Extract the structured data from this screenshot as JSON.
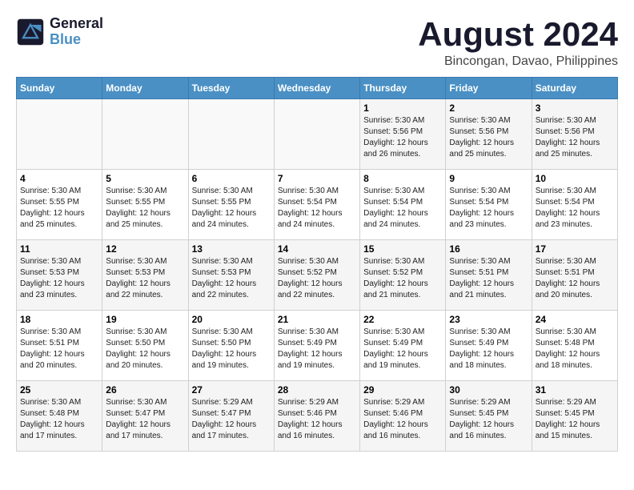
{
  "header": {
    "logo_line1": "General",
    "logo_line2": "Blue",
    "title": "August 2024",
    "subtitle": "Bincongan, Davao, Philippines"
  },
  "days_of_week": [
    "Sunday",
    "Monday",
    "Tuesday",
    "Wednesday",
    "Thursday",
    "Friday",
    "Saturday"
  ],
  "weeks": [
    [
      {
        "day": "",
        "detail": ""
      },
      {
        "day": "",
        "detail": ""
      },
      {
        "day": "",
        "detail": ""
      },
      {
        "day": "",
        "detail": ""
      },
      {
        "day": "1",
        "detail": "Sunrise: 5:30 AM\nSunset: 5:56 PM\nDaylight: 12 hours\nand 26 minutes."
      },
      {
        "day": "2",
        "detail": "Sunrise: 5:30 AM\nSunset: 5:56 PM\nDaylight: 12 hours\nand 25 minutes."
      },
      {
        "day": "3",
        "detail": "Sunrise: 5:30 AM\nSunset: 5:56 PM\nDaylight: 12 hours\nand 25 minutes."
      }
    ],
    [
      {
        "day": "4",
        "detail": "Sunrise: 5:30 AM\nSunset: 5:55 PM\nDaylight: 12 hours\nand 25 minutes."
      },
      {
        "day": "5",
        "detail": "Sunrise: 5:30 AM\nSunset: 5:55 PM\nDaylight: 12 hours\nand 25 minutes."
      },
      {
        "day": "6",
        "detail": "Sunrise: 5:30 AM\nSunset: 5:55 PM\nDaylight: 12 hours\nand 24 minutes."
      },
      {
        "day": "7",
        "detail": "Sunrise: 5:30 AM\nSunset: 5:54 PM\nDaylight: 12 hours\nand 24 minutes."
      },
      {
        "day": "8",
        "detail": "Sunrise: 5:30 AM\nSunset: 5:54 PM\nDaylight: 12 hours\nand 24 minutes."
      },
      {
        "day": "9",
        "detail": "Sunrise: 5:30 AM\nSunset: 5:54 PM\nDaylight: 12 hours\nand 23 minutes."
      },
      {
        "day": "10",
        "detail": "Sunrise: 5:30 AM\nSunset: 5:54 PM\nDaylight: 12 hours\nand 23 minutes."
      }
    ],
    [
      {
        "day": "11",
        "detail": "Sunrise: 5:30 AM\nSunset: 5:53 PM\nDaylight: 12 hours\nand 23 minutes."
      },
      {
        "day": "12",
        "detail": "Sunrise: 5:30 AM\nSunset: 5:53 PM\nDaylight: 12 hours\nand 22 minutes."
      },
      {
        "day": "13",
        "detail": "Sunrise: 5:30 AM\nSunset: 5:53 PM\nDaylight: 12 hours\nand 22 minutes."
      },
      {
        "day": "14",
        "detail": "Sunrise: 5:30 AM\nSunset: 5:52 PM\nDaylight: 12 hours\nand 22 minutes."
      },
      {
        "day": "15",
        "detail": "Sunrise: 5:30 AM\nSunset: 5:52 PM\nDaylight: 12 hours\nand 21 minutes."
      },
      {
        "day": "16",
        "detail": "Sunrise: 5:30 AM\nSunset: 5:51 PM\nDaylight: 12 hours\nand 21 minutes."
      },
      {
        "day": "17",
        "detail": "Sunrise: 5:30 AM\nSunset: 5:51 PM\nDaylight: 12 hours\nand 20 minutes."
      }
    ],
    [
      {
        "day": "18",
        "detail": "Sunrise: 5:30 AM\nSunset: 5:51 PM\nDaylight: 12 hours\nand 20 minutes."
      },
      {
        "day": "19",
        "detail": "Sunrise: 5:30 AM\nSunset: 5:50 PM\nDaylight: 12 hours\nand 20 minutes."
      },
      {
        "day": "20",
        "detail": "Sunrise: 5:30 AM\nSunset: 5:50 PM\nDaylight: 12 hours\nand 19 minutes."
      },
      {
        "day": "21",
        "detail": "Sunrise: 5:30 AM\nSunset: 5:49 PM\nDaylight: 12 hours\nand 19 minutes."
      },
      {
        "day": "22",
        "detail": "Sunrise: 5:30 AM\nSunset: 5:49 PM\nDaylight: 12 hours\nand 19 minutes."
      },
      {
        "day": "23",
        "detail": "Sunrise: 5:30 AM\nSunset: 5:49 PM\nDaylight: 12 hours\nand 18 minutes."
      },
      {
        "day": "24",
        "detail": "Sunrise: 5:30 AM\nSunset: 5:48 PM\nDaylight: 12 hours\nand 18 minutes."
      }
    ],
    [
      {
        "day": "25",
        "detail": "Sunrise: 5:30 AM\nSunset: 5:48 PM\nDaylight: 12 hours\nand 17 minutes."
      },
      {
        "day": "26",
        "detail": "Sunrise: 5:30 AM\nSunset: 5:47 PM\nDaylight: 12 hours\nand 17 minutes."
      },
      {
        "day": "27",
        "detail": "Sunrise: 5:29 AM\nSunset: 5:47 PM\nDaylight: 12 hours\nand 17 minutes."
      },
      {
        "day": "28",
        "detail": "Sunrise: 5:29 AM\nSunset: 5:46 PM\nDaylight: 12 hours\nand 16 minutes."
      },
      {
        "day": "29",
        "detail": "Sunrise: 5:29 AM\nSunset: 5:46 PM\nDaylight: 12 hours\nand 16 minutes."
      },
      {
        "day": "30",
        "detail": "Sunrise: 5:29 AM\nSunset: 5:45 PM\nDaylight: 12 hours\nand 16 minutes."
      },
      {
        "day": "31",
        "detail": "Sunrise: 5:29 AM\nSunset: 5:45 PM\nDaylight: 12 hours\nand 15 minutes."
      }
    ]
  ]
}
